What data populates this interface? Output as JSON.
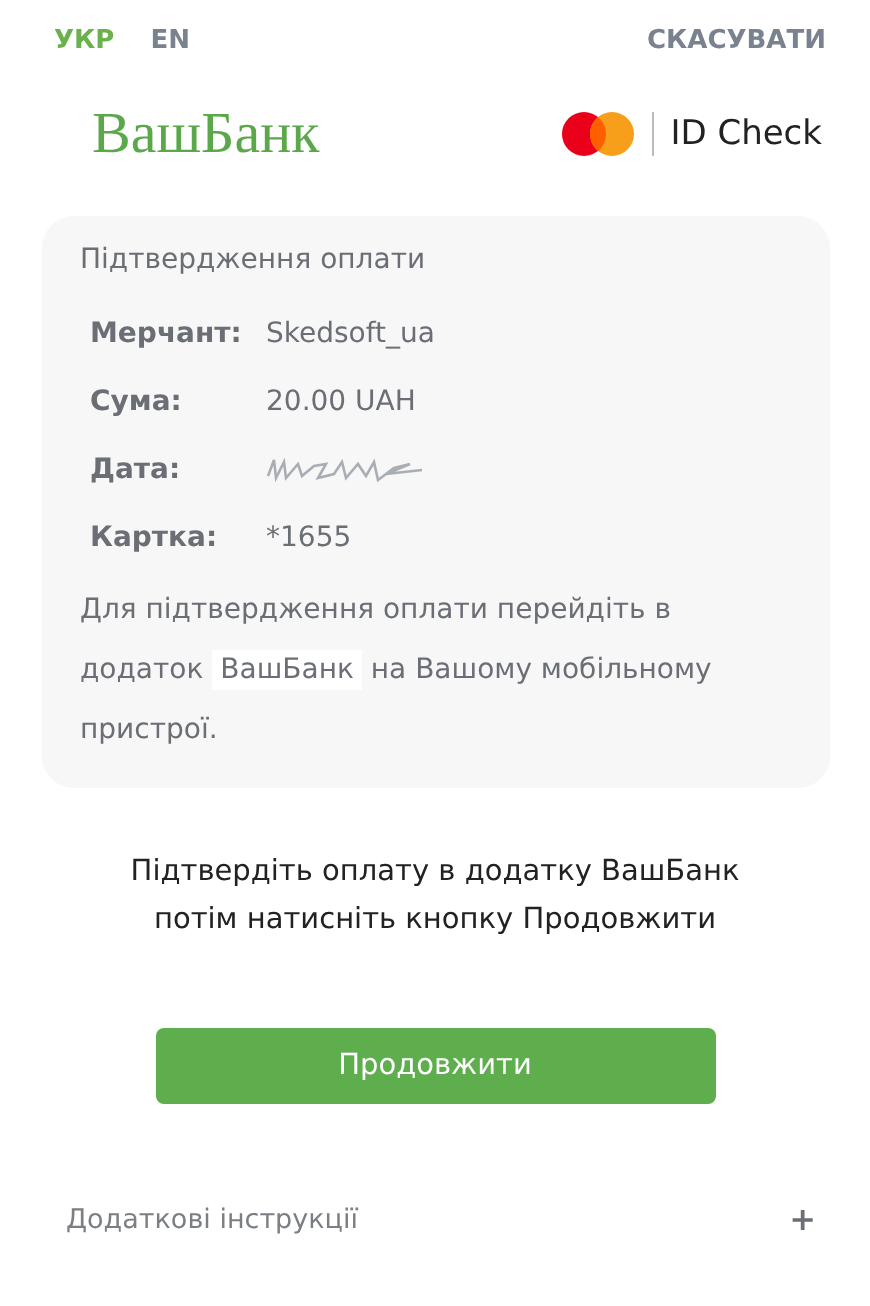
{
  "languages": [
    {
      "label": "УКР",
      "selected": true
    },
    {
      "label": "EN",
      "selected": false
    }
  ],
  "cancel": "СКАСУВАТИ",
  "bank_logo": "ВашБанк",
  "id_check": "ID Check",
  "card": {
    "title": "Підтвердження оплати",
    "details": [
      {
        "kind": "text",
        "label": "Мерчант:",
        "value": "Skedsoft_ua"
      },
      {
        "kind": "text",
        "label": "Сума:",
        "value": "20.00 UAH"
      },
      {
        "kind": "redacted",
        "label": "Дата:"
      },
      {
        "kind": "text",
        "label": "Картка:",
        "value": "*1655"
      }
    ],
    "note": {
      "before": "Для підтвердження оплати перейдіть в додаток",
      "app": "ВашБанк",
      "after": "на Вашому мобільному пристрої."
    }
  },
  "instruction": [
    "Підтвердіть оплату в додатку ВашБанк",
    "потім натисніть кнопку Продовжити"
  ],
  "continue_button": "Продовжити",
  "extra": {
    "label": "Додаткові інструкції",
    "toggle": "+",
    "expanded": false
  }
}
